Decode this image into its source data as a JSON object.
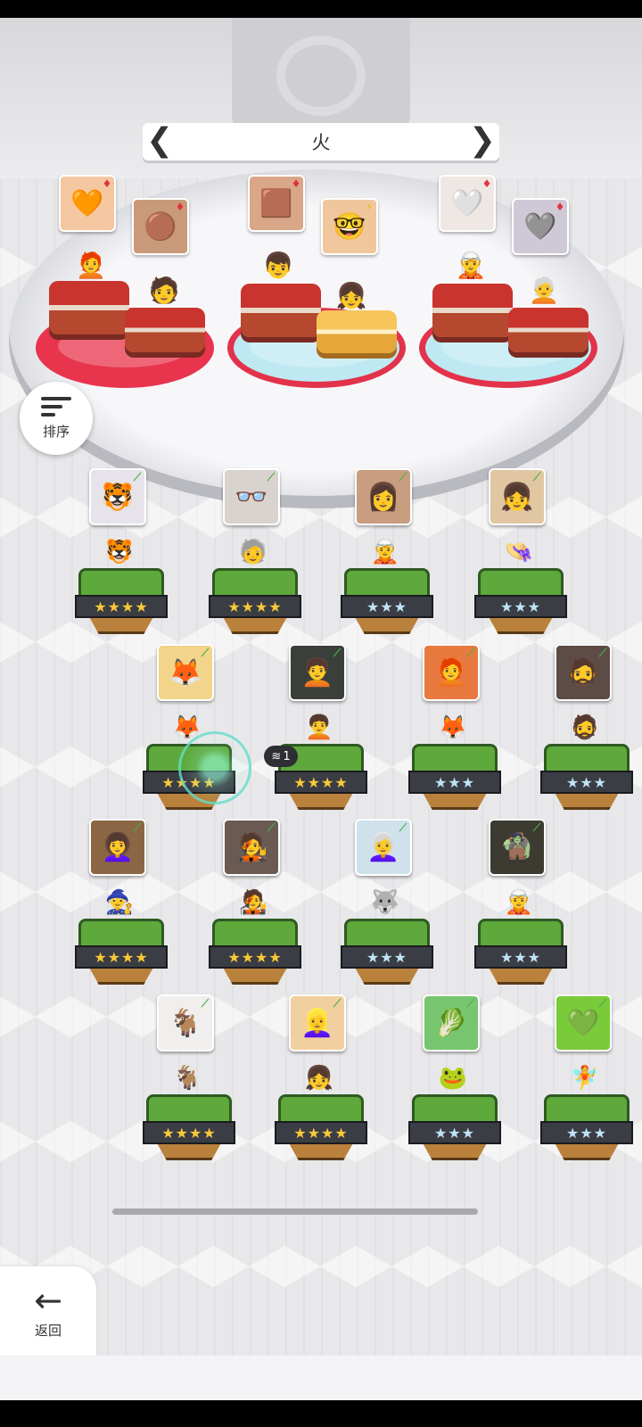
{
  "header": {
    "element_title": "火",
    "prev_arrow": "❮",
    "next_arrow": "❯"
  },
  "sort_button": {
    "label": "排序",
    "icon": "sort-icon"
  },
  "back_button": {
    "label": "返回",
    "icon": "arrow-left-icon",
    "arrow": "←"
  },
  "colors": {
    "fire_badge": "#e0323f",
    "bolt_badge": "#f2b411",
    "leaf_badge": "#48b04a",
    "star_gold": "#f7c838",
    "star_silver": "#bfe3f6",
    "pad_red": "#e8344d",
    "pad_cyan": "#bfe9f2"
  },
  "team": {
    "pads": [
      {
        "name": "pad-1",
        "style": "red",
        "members": [
          {
            "portrait": "🧡",
            "badge": "♦",
            "badge_type": "fire",
            "sprite": "🧑‍🦰"
          },
          {
            "portrait": "🟤",
            "badge": "♦",
            "badge_type": "fire",
            "sprite": "🧑"
          }
        ]
      },
      {
        "name": "pad-2",
        "style": "cyan",
        "members": [
          {
            "portrait": "🟫",
            "badge": "♦",
            "badge_type": "fire",
            "sprite": "👦"
          },
          {
            "portrait": "🤓",
            "badge": "⚡",
            "badge_type": "bolt",
            "sprite": "👧"
          }
        ]
      },
      {
        "name": "pad-3",
        "style": "cyan",
        "members": [
          {
            "portrait": "🤍",
            "badge": "♦",
            "badge_type": "fire",
            "sprite": "🧝"
          },
          {
            "portrait": "🩶",
            "badge": "♦",
            "badge_type": "fire",
            "sprite": "🧑‍🦳"
          }
        ]
      }
    ]
  },
  "roster": [
    {
      "portrait": "🐯",
      "badge": "⟋",
      "stars": "★★★★",
      "tier": "gold",
      "sprite": "🐯"
    },
    {
      "portrait": "👓",
      "badge": "⟋",
      "stars": "★★★★",
      "tier": "gold",
      "sprite": "🧓"
    },
    {
      "portrait": "👩",
      "badge": "⟋",
      "stars": "★★★",
      "tier": "silver",
      "sprite": "🧝"
    },
    {
      "portrait": "👧",
      "badge": "⟋",
      "stars": "★★★",
      "tier": "silver",
      "sprite": "👒"
    },
    {
      "portrait": "🦊",
      "badge": "⟋",
      "stars": "★★★★",
      "tier": "gold",
      "sprite": "🦊"
    },
    {
      "portrait": "🧑‍🦱",
      "badge": "⟋",
      "stars": "★★★★",
      "tier": "gold",
      "sprite": "🧑‍🦱"
    },
    {
      "portrait": "🧑‍🦰",
      "badge": "⟋",
      "stars": "★★★",
      "tier": "silver",
      "sprite": "🦊"
    },
    {
      "portrait": "🧔",
      "badge": "⟋",
      "stars": "★★★",
      "tier": "silver",
      "sprite": "🧔"
    },
    {
      "portrait": "👩‍🦱",
      "badge": "⟋",
      "stars": "★★★★",
      "tier": "gold",
      "sprite": "🧙"
    },
    {
      "portrait": "🧑‍🎤",
      "badge": "⟋",
      "stars": "★★★★",
      "tier": "gold",
      "sprite": "🧑‍🎤"
    },
    {
      "portrait": "👩‍🦳",
      "badge": "⟋",
      "stars": "★★★",
      "tier": "silver",
      "sprite": "🐺"
    },
    {
      "portrait": "🧌",
      "badge": "⟋",
      "stars": "★★★",
      "tier": "silver",
      "sprite": "🧝"
    },
    {
      "portrait": "🐐",
      "badge": "⟋",
      "stars": "★★★★",
      "tier": "gold",
      "sprite": "🐐"
    },
    {
      "portrait": "👱‍♀️",
      "badge": "⟋",
      "stars": "★★★★",
      "tier": "gold",
      "sprite": "👧"
    },
    {
      "portrait": "🥬",
      "badge": "⟋",
      "stars": "★★★",
      "tier": "silver",
      "sprite": "🐸"
    },
    {
      "portrait": "💚",
      "badge": "⟋",
      "stars": "★★★",
      "tier": "silver",
      "sprite": "🧚"
    }
  ],
  "dupe_badge": {
    "count": "1",
    "icon": "stack-icon"
  }
}
